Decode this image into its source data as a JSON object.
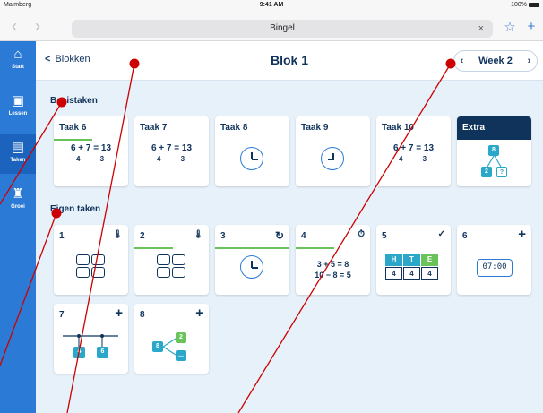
{
  "status": {
    "carrier": "Malmberg",
    "time": "9:41 AM",
    "battery": "100%"
  },
  "browser": {
    "url_title": "Bingel",
    "back": "‹",
    "forward": "›",
    "close": "×",
    "star": "☆",
    "plus": "+"
  },
  "sidebar": {
    "items": [
      {
        "label": "Start",
        "icon": "⌂"
      },
      {
        "label": "Lessen",
        "icon": "▣"
      },
      {
        "label": "Taken",
        "icon": "▤"
      },
      {
        "label": "Groei",
        "icon": "♜"
      }
    ]
  },
  "header": {
    "back_label": "Blokken",
    "title": "Blok 1",
    "week_label": "Week 2",
    "prev": "‹",
    "next": "›"
  },
  "sections": {
    "basis": "Basistaken",
    "eigen": "Eigen taken"
  },
  "basistaken": [
    {
      "title": "Taak 6",
      "eq": "6 + 7 = 13",
      "split": "4 3"
    },
    {
      "title": "Taak 7",
      "eq": "6 + 7 = 13",
      "split": "4 3"
    },
    {
      "title": "Taak 8"
    },
    {
      "title": "Taak 9"
    },
    {
      "title": "Taak 10",
      "eq": "6 + 7 = 13",
      "split": "4 3"
    },
    {
      "title": "Extra",
      "top": "8",
      "left": "2",
      "right": "?"
    }
  ],
  "eigen": [
    {
      "title": "1",
      "icon": "🌡"
    },
    {
      "title": "2",
      "icon": "🌡"
    },
    {
      "title": "3",
      "icon": "↻"
    },
    {
      "title": "4",
      "icon": "⏱",
      "eq1": "3 + 5 = 8",
      "eq2": "10 − 8 = 5"
    },
    {
      "title": "5",
      "icon": "✓",
      "h": "H",
      "t": "T",
      "e": "E",
      "vh": "4",
      "vt": "4",
      "ve": "4"
    },
    {
      "title": "6",
      "icon": "+",
      "time": "07:00"
    },
    {
      "title": "7",
      "icon": "+",
      "a": "4",
      "b": "6"
    },
    {
      "title": "8",
      "icon": "+",
      "a": "8",
      "b": "2",
      "c": "..."
    }
  ],
  "colors": {
    "sidebar": "#2b7bd6",
    "sidebar_active": "#1b63bd",
    "navy": "#10335c",
    "progress": "#69c35a",
    "annotation": "#cc0000"
  }
}
